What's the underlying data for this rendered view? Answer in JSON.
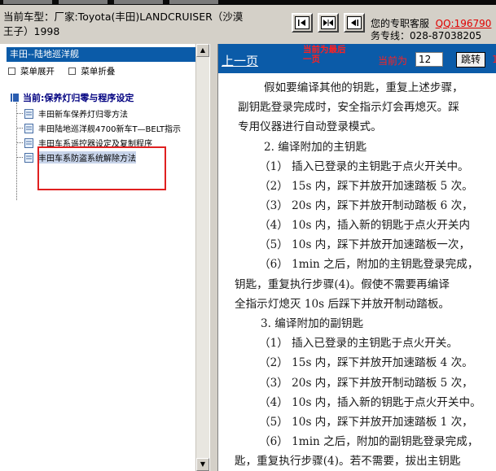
{
  "header": {
    "car_line1": "当前车型：厂家:Toyota(丰田)LANDCRUISER（沙漠",
    "car_line2": "王子）1998",
    "support_line1_label": "您的专职客服",
    "support_qq": "QQ:196790",
    "support_line2": "务专线：028-87038205"
  },
  "sidebar": {
    "title": "丰田--陆地巡洋舰",
    "expand_label": "菜单展开",
    "collapse_label": "菜单折叠",
    "root_label": "当前:保养灯归零与程序设定",
    "items": [
      {
        "label": "丰田新车保养灯归零方法"
      },
      {
        "label": "丰田陆地巡洋舰4700新车T—BELT指示"
      },
      {
        "label": "丰田车系遥控器设定及复制程序"
      },
      {
        "label": "丰田车系防盗系统解除方法"
      }
    ]
  },
  "doc": {
    "prev_label": "上一页",
    "notice": "当前为最后一页",
    "current_label": "当前为",
    "page_value": "12",
    "jump_label": "跳转",
    "edge_number": "1",
    "lines": [
      "假如要编译其他的钥匙，重复上述步骤，",
      "副钥匙登录完成时，安全指示灯会再熄灭。踩",
      "专用仪器进行自动登录模式。",
      "2. 编译附加的主钥匙",
      "（1） 插入已登录的主钥匙于点火开关中。",
      "（2） 15s 内，踩下并放开加速踏板 5 次。",
      "（3） 20s 内，踩下并放开制动踏板 6 次，",
      "（4） 10s 内，插入新的钥匙于点火开关内",
      "（5） 10s 内，踩下并放开加速踏板一次，",
      "（6） 1min 之后，附加的主钥匙登录完成，",
      "钥匙，重复执行步骤(4)。假使不需要再编译",
      "全指示灯熄灭 10s 后踩下并放开制动踏板。",
      "3. 编译附加的副钥匙",
      "（1） 插入已登录的主钥匙于点火开关。",
      "（2） 15s 内，踩下并放开加速踏板 4 次。",
      "（3） 20s 内，踩下并放开制动踏板 5 次，",
      "（4） 10s 内，插入新的钥匙于点火开关中。",
      "（5） 10s 内，踩下并放开加速踏板 1 次，",
      "（6） 1min 之后，附加的副钥匙登录完成，",
      "匙，重复执行步骤(4)。若不需要，拔出主钥匙"
    ]
  }
}
